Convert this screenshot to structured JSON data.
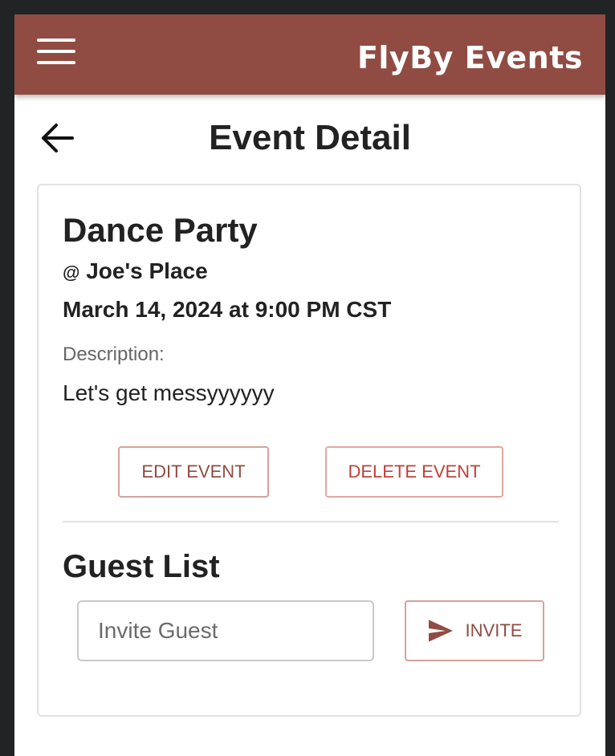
{
  "header": {
    "brand": "FlyBy Events",
    "menu_icon": "hamburger-menu-icon",
    "background_color": "#904c43"
  },
  "page": {
    "title": "Event Detail",
    "back_icon": "arrow-left-icon"
  },
  "event": {
    "name": "Dance Party",
    "venue_prefix": "@",
    "venue": "Joe's Place",
    "datetime": "March 14, 2024 at 9:00 PM CST",
    "description_label": "Description:",
    "description": "Let's get messyyyyyy"
  },
  "actions": {
    "edit_label": "EDIT EVENT",
    "delete_label": "DELETE EVENT",
    "edit_color": "#904c43",
    "delete_color": "#c0413a"
  },
  "guests": {
    "title": "Guest List",
    "invite_placeholder": "Invite Guest",
    "invite_value": "",
    "invite_button_label": "INVITE",
    "invite_icon": "send-icon"
  }
}
